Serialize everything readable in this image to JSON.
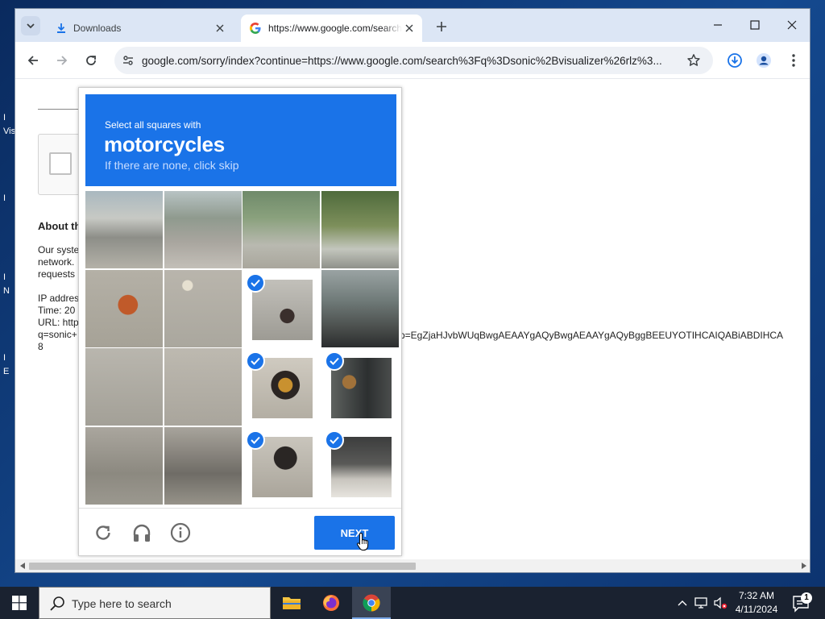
{
  "desktop": {
    "icon_labels": [
      "I",
      "Vis",
      "I",
      "I",
      "N",
      "I",
      "E"
    ]
  },
  "browser": {
    "tabs": [
      {
        "title": "Downloads",
        "active": false,
        "icon": "download-icon"
      },
      {
        "title": "https://www.google.com/search?q=sonic",
        "active": true,
        "icon": "google-g-icon"
      }
    ],
    "url": "google.com/sorry/index?continue=https://www.google.com/search%3Fq%3Dsonic%2Bvisualizer%26rlz%3..."
  },
  "page": {
    "about_heading": "About th",
    "paragraph_lines": [
      "Our syste",
      "network.",
      "requests"
    ],
    "info_lines": [
      "IP addres",
      "Time: 20",
      "URL: http",
      "q=sonic+",
      "8"
    ],
    "url_tail": "p=EgZjaHJvbWUqBwgAEAAYgAQyBwgAEAAYgAQyBggBEEUYOTIHCAIQABiABDIHCA"
  },
  "captcha": {
    "instruction_small": "Select all squares with",
    "target": "motorcycles",
    "hint": "If there are none, click skip",
    "selected_cells": [
      6,
      10,
      11,
      14,
      15
    ],
    "next_label": "NEXT",
    "accent_color": "#1a73e8"
  },
  "taskbar": {
    "search_placeholder": "Type here to search",
    "time": "7:32 AM",
    "date": "4/11/2024",
    "notification_count": "1"
  }
}
